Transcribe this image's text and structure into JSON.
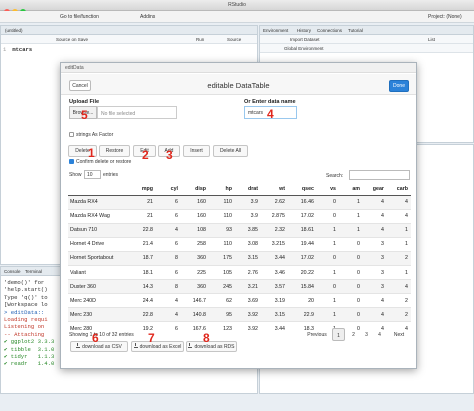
{
  "window_title": "RStudio",
  "toolbar": {
    "go_to_file": "Go to file/function",
    "addins": "Addins",
    "project": "Project: (None)"
  },
  "editor": {
    "tab": "(untitled)",
    "source_on_save": "Source on Save",
    "run": "Run",
    "source": "Source",
    "line_number": "1",
    "code": "mtcars"
  },
  "env_pane": {
    "tabs": [
      "Environment",
      "History",
      "Connections",
      "Tutorial"
    ],
    "import_dataset": "Import Dataset",
    "scope": "Global Environment",
    "list": "List"
  },
  "console": {
    "tabs": [
      "Console",
      "Terminal"
    ],
    "lines": [
      {
        "text": "'demo()' for",
        "cls": ""
      },
      {
        "text": "'help.start()",
        "cls": ""
      },
      {
        "text": "Type 'q()' to",
        "cls": ""
      },
      {
        "text": "",
        "cls": ""
      },
      {
        "text": "[Workspace lo",
        "cls": ""
      },
      {
        "text": "",
        "cls": ""
      },
      {
        "text": "> editData::",
        "cls": "blue"
      },
      {
        "text": "Loading requi",
        "cls": "err"
      },
      {
        "text": "",
        "cls": ""
      },
      {
        "text": "Listening on",
        "cls": "err"
      },
      {
        "text": "-- Attaching",
        "cls": "err"
      },
      {
        "text": "",
        "cls": ""
      },
      {
        "text": "✔ ggplot2 3.3.3     ✔ purrr   0.3.4",
        "cls": "ok"
      },
      {
        "text": "✔ tibble  3.1.0     ✔ dplyr   1.0.5",
        "cls": "ok"
      },
      {
        "text": "✔ tidyr   1.1.3     ✔ stringr 1.4.0",
        "cls": "ok"
      },
      {
        "text": "✔ readr   1.4.0     ✔ forcats 0.5.1",
        "cls": "ok"
      }
    ]
  },
  "modal": {
    "titlebar": "editData",
    "title": "editable DataTable",
    "cancel": "Cancel",
    "done": "Done",
    "upload_label": "Upload File",
    "browse": "Browse...",
    "no_file": "No file selected",
    "data_name_label": "Or Enter data name",
    "data_name_value": "mtcars",
    "strings_as_factor": "strings As Factor",
    "buttons": {
      "delete": "Delete",
      "restore": "Restore",
      "edit": "Edit",
      "add": "Add",
      "insert": "Insert",
      "delete_all": "Delete All"
    },
    "confirm": "Confirm delete or restore",
    "show": "Show",
    "page_length": "10",
    "entries": "entries",
    "search": "Search:",
    "table": {
      "columns": [
        "",
        "mpg",
        "cyl",
        "disp",
        "hp",
        "drat",
        "wt",
        "qsec",
        "vs",
        "am",
        "gear",
        "carb"
      ],
      "rows": [
        [
          "Mazda RX4",
          "21",
          "6",
          "160",
          "110",
          "3.9",
          "2.62",
          "16.46",
          "0",
          "1",
          "4",
          "4"
        ],
        [
          "Mazda RX4 Wag",
          "21",
          "6",
          "160",
          "110",
          "3.9",
          "2.875",
          "17.02",
          "0",
          "1",
          "4",
          "4"
        ],
        [
          "Datsun 710",
          "22.8",
          "4",
          "108",
          "93",
          "3.85",
          "2.32",
          "18.61",
          "1",
          "1",
          "4",
          "1"
        ],
        [
          "Hornet 4 Drive",
          "21.4",
          "6",
          "258",
          "110",
          "3.08",
          "3.215",
          "19.44",
          "1",
          "0",
          "3",
          "1"
        ],
        [
          "Hornet Sportabout",
          "18.7",
          "8",
          "360",
          "175",
          "3.15",
          "3.44",
          "17.02",
          "0",
          "0",
          "3",
          "2"
        ],
        [
          "Valiant",
          "18.1",
          "6",
          "225",
          "105",
          "2.76",
          "3.46",
          "20.22",
          "1",
          "0",
          "3",
          "1"
        ],
        [
          "Duster 360",
          "14.3",
          "8",
          "360",
          "245",
          "3.21",
          "3.57",
          "15.84",
          "0",
          "0",
          "3",
          "4"
        ],
        [
          "Merc 240D",
          "24.4",
          "4",
          "146.7",
          "62",
          "3.69",
          "3.19",
          "20",
          "1",
          "0",
          "4",
          "2"
        ],
        [
          "Merc 230",
          "22.8",
          "4",
          "140.8",
          "95",
          "3.92",
          "3.15",
          "22.9",
          "1",
          "0",
          "4",
          "2"
        ],
        [
          "Merc 280",
          "19.2",
          "6",
          "167.6",
          "123",
          "3.92",
          "3.44",
          "18.3",
          "1",
          "0",
          "4",
          "4"
        ]
      ]
    },
    "info": "Showing 1 to 10 of 32 entries",
    "pagination": {
      "previous": "Previous",
      "pages": [
        "1",
        "2",
        "3",
        "4"
      ],
      "next": "Next"
    },
    "downloads": {
      "csv": "download as CSV",
      "excel": "download as Excel",
      "rds": "download as RDS"
    }
  },
  "annotations": [
    "1",
    "2",
    "3",
    "4",
    "5",
    "6",
    "7",
    "8"
  ],
  "colors": {
    "accent": "#2b82d9",
    "annotation": "#e0271c"
  }
}
